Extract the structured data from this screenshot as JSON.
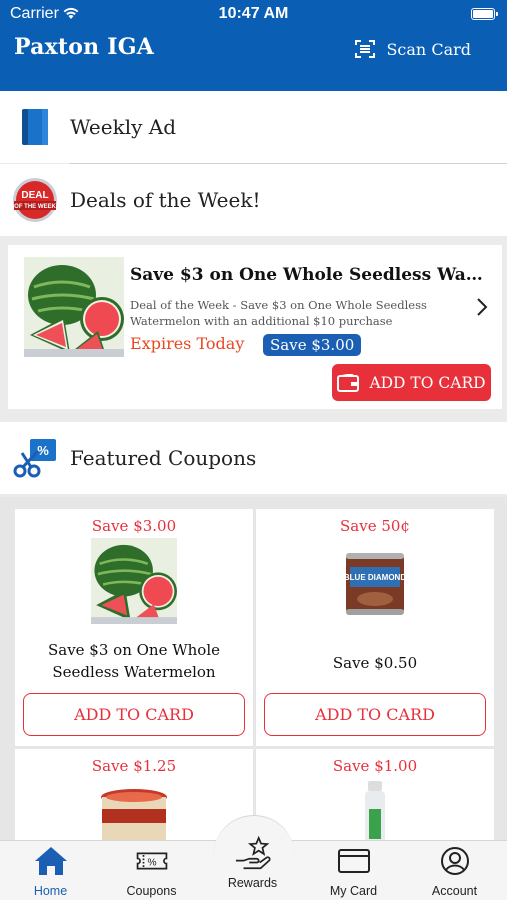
{
  "status": {
    "carrier": "Carrier",
    "time": "10:47 AM"
  },
  "header": {
    "title": "Paxton IGA",
    "scan_label": "Scan Card"
  },
  "sections": {
    "weekly_ad": "Weekly Ad",
    "deals": "Deals of the Week!",
    "deal_badge_text": "DEAL OF THE WEEK",
    "featured": "Featured Coupons"
  },
  "deal": {
    "title": "Save $3 on One Whole Seedless Waterm...",
    "description": "Deal of the Week  - Save $3 on One Whole Seedless Watermelon with an additional $10 purchase",
    "expires": "Expires Today",
    "save_badge": "Save $3.00",
    "add_label": "ADD TO CARD"
  },
  "coupons": [
    {
      "save": "Save $3.00",
      "name": "Save $3 on One Whole Seedless Watermelon",
      "add_label": "ADD TO CARD"
    },
    {
      "save": "Save 50¢",
      "name": "Save $0.50",
      "add_label": "ADD TO CARD",
      "brand_text": "BLUE DIAMOND"
    },
    {
      "save": "Save $1.25"
    },
    {
      "save": "Save $1.00"
    }
  ],
  "tabs": [
    {
      "label": "Home",
      "icon": "home-icon",
      "active": true
    },
    {
      "label": "Coupons",
      "icon": "coupons-icon",
      "active": false
    },
    {
      "label": "Rewards",
      "icon": "rewards-icon",
      "active": false
    },
    {
      "label": "My Card",
      "icon": "card-icon",
      "active": false
    },
    {
      "label": "Account",
      "icon": "account-icon",
      "active": false
    }
  ],
  "colors": {
    "brand_blue": "#0a5eb4",
    "accent_red": "#e8303a",
    "expires_orange": "#e8481e"
  }
}
